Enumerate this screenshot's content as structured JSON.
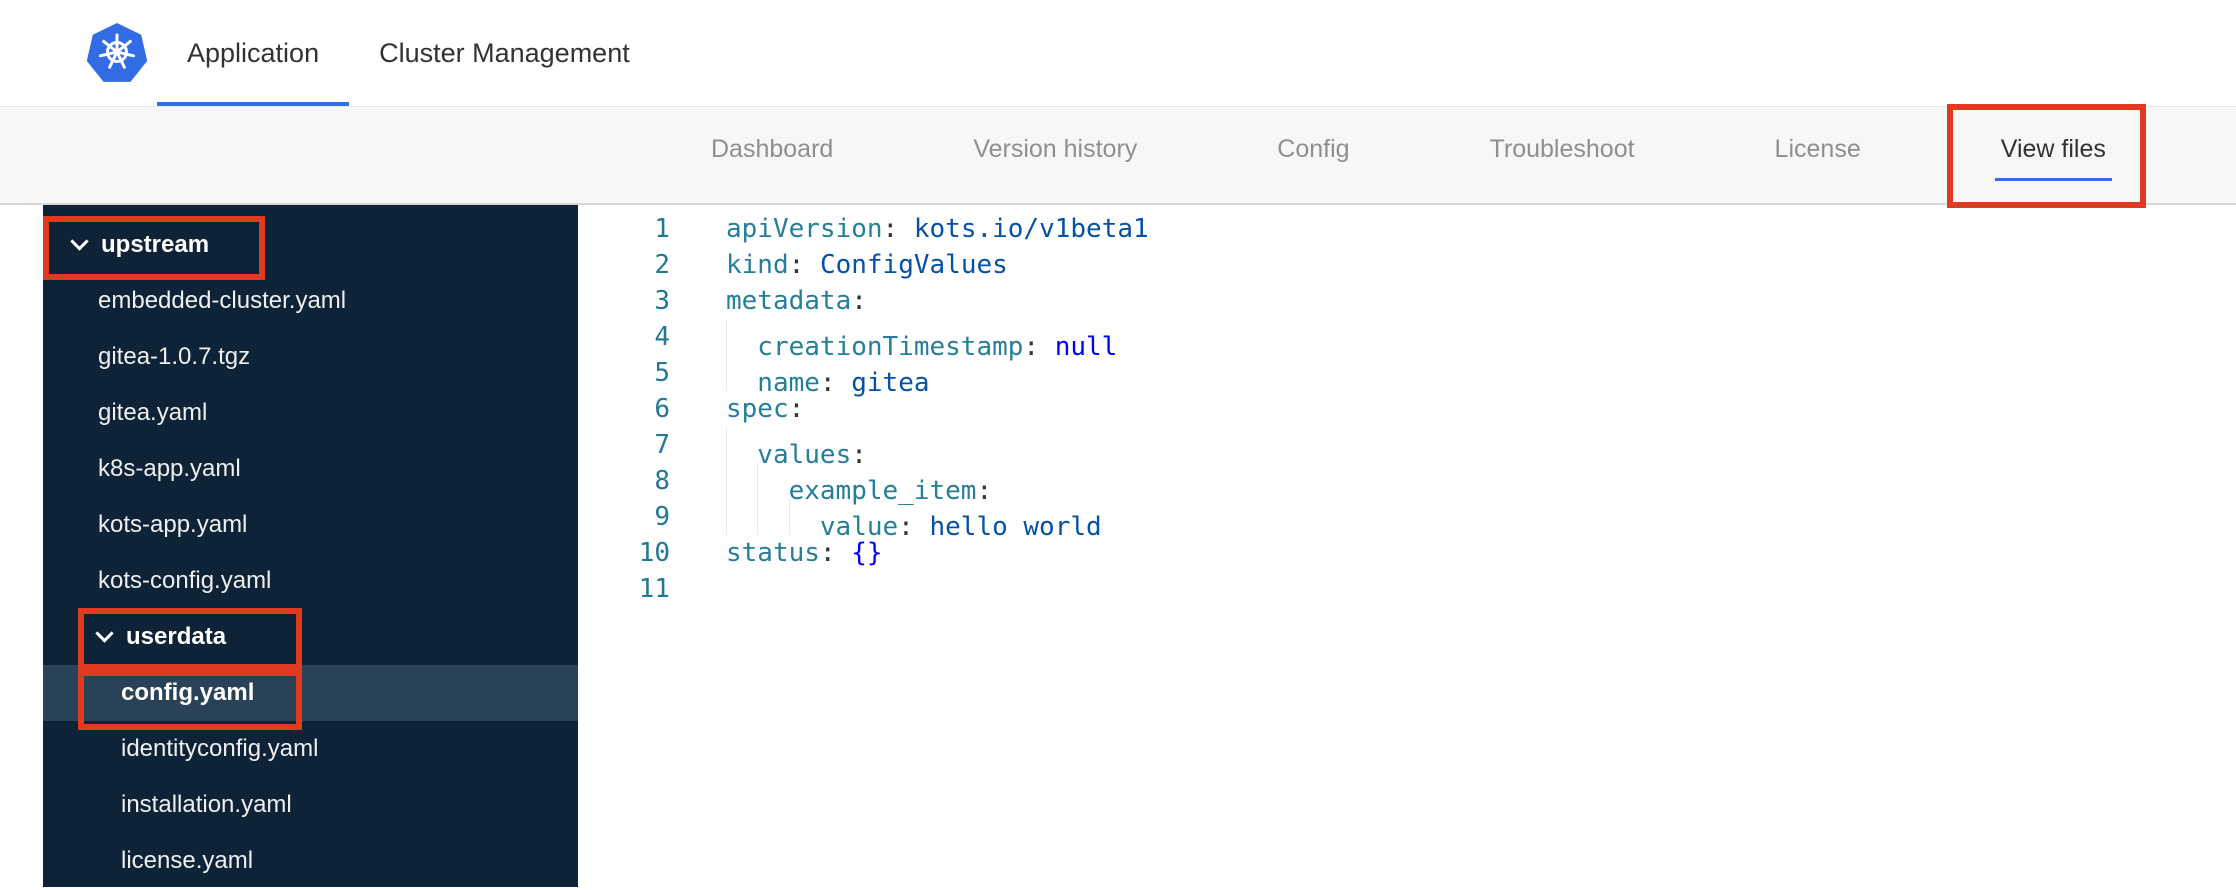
{
  "colors": {
    "accent": "#326de6",
    "annotation": "#e03a21",
    "sidebar": "#0e2337",
    "selected": "#2a4258",
    "key": "#267f99",
    "str": "#0451a5",
    "kw": "#0000ff",
    "linenum": "#237893"
  },
  "icons": {
    "logo": "kubernetes-helm-wheel",
    "folder_toggle": "chevron-down"
  },
  "header": {
    "tabs": [
      {
        "label": "Application",
        "active": true
      },
      {
        "label": "Cluster Management",
        "active": false
      }
    ]
  },
  "subnav": {
    "items": [
      {
        "label": "Dashboard",
        "active": false,
        "annotated": false
      },
      {
        "label": "Version history",
        "active": false,
        "annotated": false
      },
      {
        "label": "Config",
        "active": false,
        "annotated": false
      },
      {
        "label": "Troubleshoot",
        "active": false,
        "annotated": false
      },
      {
        "label": "License",
        "active": false,
        "annotated": false
      },
      {
        "label": "View files",
        "active": true,
        "annotated": true
      }
    ]
  },
  "file_tree": [
    {
      "type": "folder",
      "label": "upstream",
      "depth": 0,
      "expanded": true,
      "annotated": true
    },
    {
      "type": "file",
      "label": "embedded-cluster.yaml",
      "depth": 1
    },
    {
      "type": "file",
      "label": "gitea-1.0.7.tgz",
      "depth": 1
    },
    {
      "type": "file",
      "label": "gitea.yaml",
      "depth": 1
    },
    {
      "type": "file",
      "label": "k8s-app.yaml",
      "depth": 1
    },
    {
      "type": "file",
      "label": "kots-app.yaml",
      "depth": 1
    },
    {
      "type": "file",
      "label": "kots-config.yaml",
      "depth": 1
    },
    {
      "type": "folder",
      "label": "userdata",
      "depth": 1,
      "expanded": true,
      "annotated": true
    },
    {
      "type": "file",
      "label": "config.yaml",
      "depth": 2,
      "selected": true,
      "annotated": true
    },
    {
      "type": "file",
      "label": "identityconfig.yaml",
      "depth": 2
    },
    {
      "type": "file",
      "label": "installation.yaml",
      "depth": 2
    },
    {
      "type": "file",
      "label": "license.yaml",
      "depth": 2
    }
  ],
  "editor": {
    "language": "yaml",
    "lines": [
      {
        "num": "1",
        "indent": 0,
        "tokens": [
          {
            "c": "key",
            "t": "apiVersion"
          },
          {
            "c": "colon",
            "t": ": "
          },
          {
            "c": "str",
            "t": "kots.io/v1beta1"
          }
        ]
      },
      {
        "num": "2",
        "indent": 0,
        "tokens": [
          {
            "c": "key",
            "t": "kind"
          },
          {
            "c": "colon",
            "t": ": "
          },
          {
            "c": "str",
            "t": "ConfigValues"
          }
        ]
      },
      {
        "num": "3",
        "indent": 0,
        "tokens": [
          {
            "c": "key",
            "t": "metadata"
          },
          {
            "c": "colon",
            "t": ":"
          }
        ]
      },
      {
        "num": "4",
        "indent": 1,
        "tokens": [
          {
            "c": "key",
            "t": "creationTimestamp"
          },
          {
            "c": "colon",
            "t": ": "
          },
          {
            "c": "kw",
            "t": "null"
          }
        ]
      },
      {
        "num": "5",
        "indent": 1,
        "tokens": [
          {
            "c": "key",
            "t": "name"
          },
          {
            "c": "colon",
            "t": ": "
          },
          {
            "c": "str",
            "t": "gitea"
          }
        ]
      },
      {
        "num": "6",
        "indent": 0,
        "tokens": [
          {
            "c": "key",
            "t": "spec"
          },
          {
            "c": "colon",
            "t": ":"
          }
        ]
      },
      {
        "num": "7",
        "indent": 1,
        "tokens": [
          {
            "c": "key",
            "t": "values"
          },
          {
            "c": "colon",
            "t": ":"
          }
        ]
      },
      {
        "num": "8",
        "indent": 2,
        "tokens": [
          {
            "c": "key",
            "t": "example_item"
          },
          {
            "c": "colon",
            "t": ":"
          }
        ]
      },
      {
        "num": "9",
        "indent": 3,
        "tokens": [
          {
            "c": "key",
            "t": "value"
          },
          {
            "c": "colon",
            "t": ": "
          },
          {
            "c": "str",
            "t": "hello world"
          }
        ]
      },
      {
        "num": "10",
        "indent": 0,
        "tokens": [
          {
            "c": "key",
            "t": "status"
          },
          {
            "c": "colon",
            "t": ": "
          },
          {
            "c": "kw",
            "t": "{}"
          }
        ]
      },
      {
        "num": "11",
        "indent": 0,
        "tokens": []
      }
    ]
  }
}
